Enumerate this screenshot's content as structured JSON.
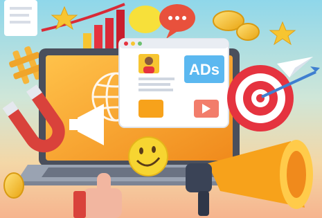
{
  "illustration": {
    "ad_panel_text": "ADs",
    "colors": {
      "sky_top": "#7fd3ea",
      "sky_bottom": "#f3d9a0",
      "floor": "#f6b48e",
      "laptop_screen": "#f5a623",
      "laptop_body": "#8c97a8",
      "target_red": "#e5333f",
      "megaphone_orange": "#f7a21b",
      "magnet_red": "#d9423b",
      "coin_gold": "#f7c531",
      "ads_blue": "#5bb8f0"
    },
    "icons": [
      "laptop-icon",
      "megaphone-icon",
      "target-icon",
      "magnet-icon",
      "coin-icon",
      "star-icon",
      "paper-plane-icon",
      "speech-bubble-icon",
      "thumbs-up-icon",
      "emoji-smile-icon",
      "globe-icon",
      "hashtag-icon",
      "arrow-icon"
    ]
  }
}
